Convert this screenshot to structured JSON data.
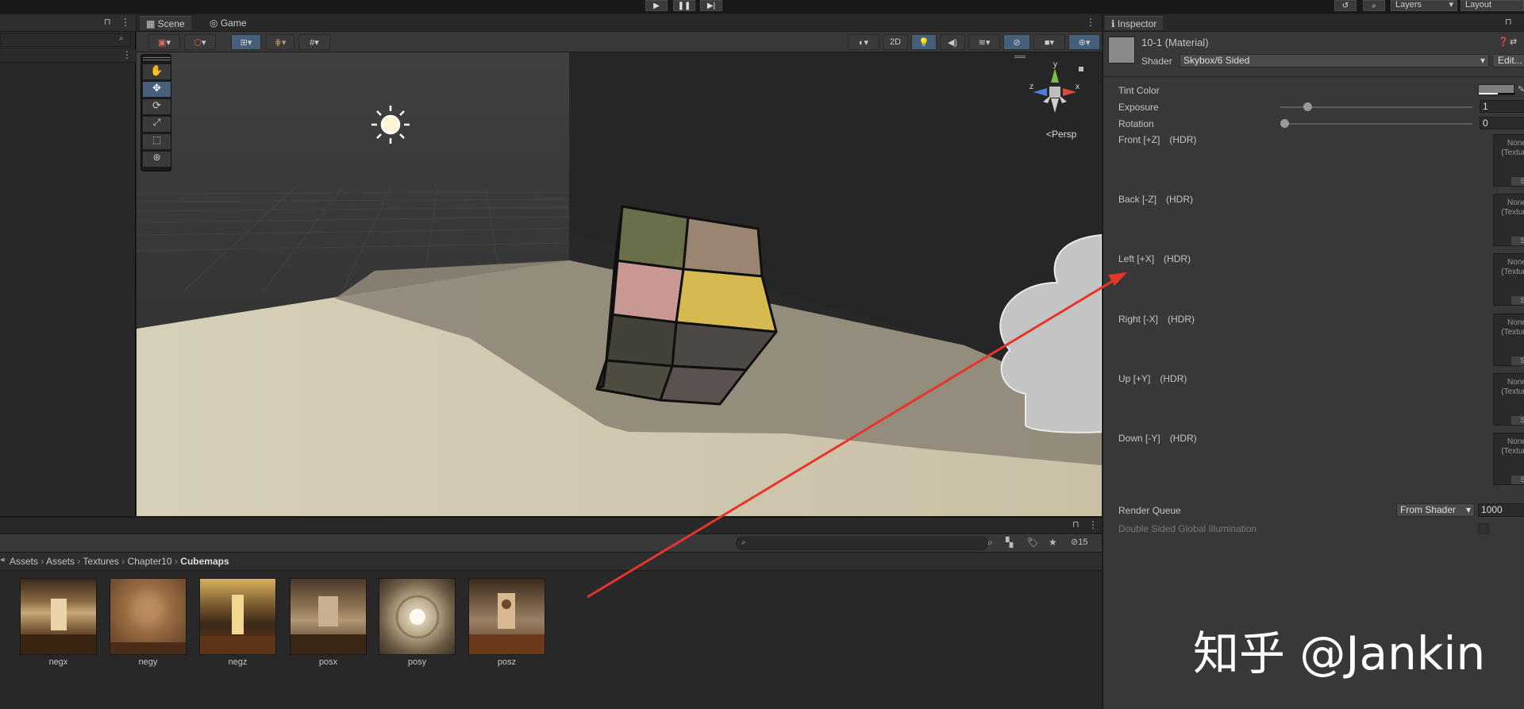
{
  "topbar": {
    "layers_label": "Layers",
    "layout_label": "Layout"
  },
  "scene_view": {
    "tabs": [
      {
        "label": "Scene"
      },
      {
        "label": "Game"
      }
    ],
    "toggle_2d_label": "2D",
    "persp_label": "<Persp",
    "gizmo_axes": {
      "y": "y",
      "x": "x",
      "z": "z"
    }
  },
  "inspector": {
    "tab_label": "Inspector",
    "material_name": "10-1 (Material)",
    "shader_label": "Shader",
    "shader_value": "Skybox/6 Sided",
    "edit_button_label": "Edit...",
    "properties": {
      "tint_color": {
        "label": "Tint Color",
        "color": "#808080"
      },
      "exposure": {
        "label": "Exposure",
        "value": "1",
        "level": 0.125
      },
      "rotation": {
        "label": "Rotation",
        "value": "0",
        "level": 0.0
      }
    },
    "textures": [
      {
        "label": "Front [+Z]",
        "hdr": "(HDR)",
        "slot_line1": "None",
        "slot_line2": "(Texture)",
        "select_label": "Selec"
      },
      {
        "label": "Back [-Z]",
        "hdr": "(HDR)",
        "slot_line1": "None",
        "slot_line2": "(Texture)",
        "select_label": "Selec"
      },
      {
        "label": "Left [+X]",
        "hdr": "(HDR)",
        "slot_line1": "None",
        "slot_line2": "(Texture)",
        "select_label": "Selec"
      },
      {
        "label": "Right [-X]",
        "hdr": "(HDR)",
        "slot_line1": "None",
        "slot_line2": "(Texture)",
        "select_label": "Selec"
      },
      {
        "label": "Up [+Y]",
        "hdr": "(HDR)",
        "slot_line1": "None",
        "slot_line2": "(Texture)",
        "select_label": "Selec"
      },
      {
        "label": "Down [-Y]",
        "hdr": "(HDR)",
        "slot_line1": "None",
        "slot_line2": "(Texture)",
        "select_label": "Selec"
      }
    ],
    "render_queue": {
      "label": "Render Queue",
      "dropdown": "From Shader",
      "value": "1000"
    },
    "double_sided_gi": {
      "label": "Double Sided Global Illumination"
    }
  },
  "project": {
    "breadcrumb": [
      "Assets",
      "Assets",
      "Textures",
      "Chapter10",
      "Cubemaps"
    ],
    "visible_count": "15",
    "assets": [
      {
        "name": "negx"
      },
      {
        "name": "negy"
      },
      {
        "name": "negz"
      },
      {
        "name": "posx"
      },
      {
        "name": "posy"
      },
      {
        "name": "posz"
      }
    ]
  },
  "watermark": "知乎 @Jankin",
  "colors": {
    "accent_blue": "#46607c",
    "annotation_arrow": "#e8352a",
    "panel_bg": "#383838"
  }
}
